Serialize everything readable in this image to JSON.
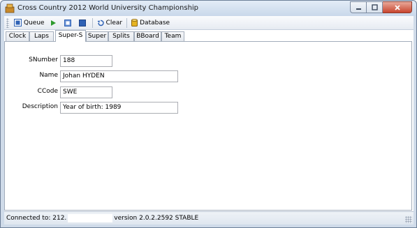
{
  "window": {
    "title": "Cross Country 2012 World University Championship"
  },
  "toolbar": {
    "queue_label": "Queue",
    "clear_label": "Clear",
    "database_label": "Database"
  },
  "tabs": [
    {
      "label": "Clock"
    },
    {
      "label": "Laps"
    },
    {
      "label": "Super-S"
    },
    {
      "label": "Super"
    },
    {
      "label": "Splits"
    },
    {
      "label": "BBoard"
    },
    {
      "label": "Team"
    }
  ],
  "active_tab": "Super-S",
  "form": {
    "snumber": {
      "label": "SNumber",
      "value": "188"
    },
    "name": {
      "label": "Name",
      "value": "Johan HYDEN"
    },
    "ccode": {
      "label": "CCode",
      "value": "SWE"
    },
    "description": {
      "label": "Description",
      "value": "Year of birth: 1989"
    }
  },
  "status": {
    "connected_prefix": "Connected to: 212.",
    "version": "version 2.0.2.2592 STABLE"
  },
  "colors": {
    "title_bar": "#c9d8ea",
    "close_button": "#c8452e",
    "play_icon": "#2e9a2e",
    "blue_icon": "#2f62b5",
    "database_icon": "#e6b422"
  },
  "icons": [
    "app-icon",
    "queue-icon",
    "play-icon",
    "step-icon",
    "stop-icon",
    "clear-icon",
    "database-icon",
    "minimize-icon",
    "maximize-icon",
    "close-icon"
  ]
}
